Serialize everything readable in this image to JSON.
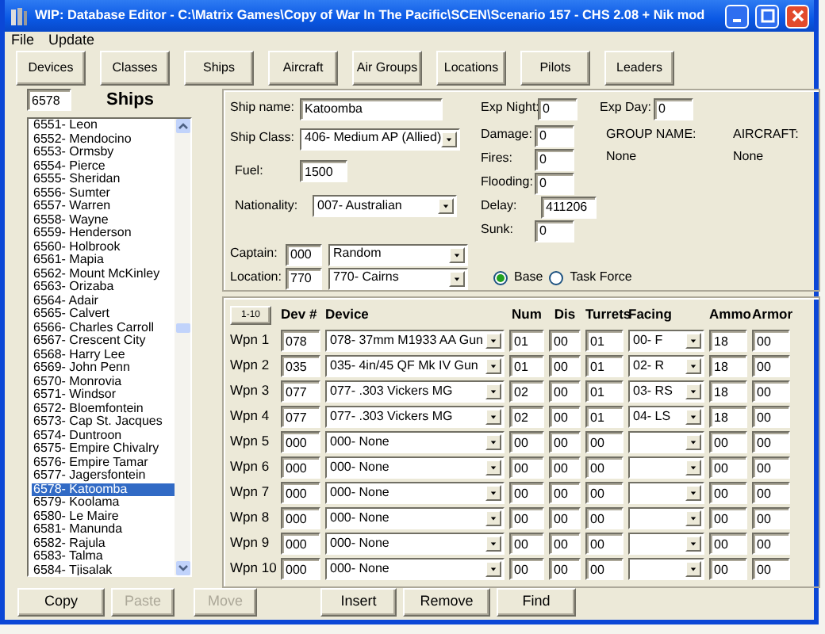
{
  "window": {
    "title": "WIP: Database Editor - C:\\Matrix Games\\Copy of War In The Pacific\\SCEN\\Scenario 157 - CHS 2.08 + Nik mod"
  },
  "menu": [
    "File",
    "Update"
  ],
  "nav_buttons": [
    "Devices",
    "Classes",
    "Ships",
    "Aircraft",
    "Air Groups",
    "Locations",
    "Pilots",
    "Leaders"
  ],
  "ship_list": {
    "search": "6578",
    "title": "Ships",
    "items": [
      {
        "label": "6551- Leon",
        "selected": false
      },
      {
        "label": "6552- Mendocino",
        "selected": false
      },
      {
        "label": "6553- Ormsby",
        "selected": false
      },
      {
        "label": "6554- Pierce",
        "selected": false
      },
      {
        "label": "6555- Sheridan",
        "selected": false
      },
      {
        "label": "6556- Sumter",
        "selected": false
      },
      {
        "label": "6557- Warren",
        "selected": false
      },
      {
        "label": "6558- Wayne",
        "selected": false
      },
      {
        "label": "6559- Henderson",
        "selected": false
      },
      {
        "label": "6560- Holbrook",
        "selected": false
      },
      {
        "label": "6561- Mapia",
        "selected": false
      },
      {
        "label": "6562- Mount McKinley",
        "selected": false
      },
      {
        "label": "6563- Orizaba",
        "selected": false
      },
      {
        "label": "6564- Adair",
        "selected": false
      },
      {
        "label": "6565- Calvert",
        "selected": false
      },
      {
        "label": "6566- Charles Carroll",
        "selected": false
      },
      {
        "label": "6567- Crescent City",
        "selected": false
      },
      {
        "label": "6568- Harry Lee",
        "selected": false
      },
      {
        "label": "6569- John Penn",
        "selected": false
      },
      {
        "label": "6570- Monrovia",
        "selected": false
      },
      {
        "label": "6571- Windsor",
        "selected": false
      },
      {
        "label": "6572- Bloemfontein",
        "selected": false
      },
      {
        "label": "6573- Cap St. Jacques",
        "selected": false
      },
      {
        "label": "6574- Duntroon",
        "selected": false
      },
      {
        "label": "6575- Empire Chivalry",
        "selected": false
      },
      {
        "label": "6576- Empire Tamar",
        "selected": false
      },
      {
        "label": "6577- Jagersfontein",
        "selected": false
      },
      {
        "label": "6578- Katoomba",
        "selected": true
      },
      {
        "label": "6579- Koolama",
        "selected": false
      },
      {
        "label": "6580- Le Maire",
        "selected": false
      },
      {
        "label": "6581- Manunda",
        "selected": false
      },
      {
        "label": "6582- Rajula",
        "selected": false
      },
      {
        "label": "6583- Talma",
        "selected": false
      },
      {
        "label": "6584- Tjisalak",
        "selected": false
      }
    ]
  },
  "ship": {
    "ship_name": {
      "label": "Ship name:",
      "value": "Katoomba"
    },
    "ship_class": {
      "label": "Ship Class:",
      "value": "406- Medium AP (Allied)"
    },
    "fuel": {
      "label": "Fuel:",
      "value": "1500"
    },
    "nationality": {
      "label": "Nationality:",
      "value": "007- Australian"
    },
    "exp_night": {
      "label": "Exp Night:",
      "value": "0"
    },
    "exp_day": {
      "label": "Exp Day:",
      "value": "0"
    },
    "damage": {
      "label": "Damage:",
      "value": "0"
    },
    "fires": {
      "label": "Fires:",
      "value": "0"
    },
    "flooding": {
      "label": "Flooding:",
      "value": "0"
    },
    "delay": {
      "label": "Delay:",
      "value": "411206"
    },
    "sunk": {
      "label": "Sunk:",
      "value": "0"
    },
    "group_name": {
      "label": "GROUP NAME:",
      "value": "None"
    },
    "aircraft": {
      "label": "AIRCRAFT:",
      "value": "None"
    },
    "captain": {
      "label": "Captain:",
      "code": "000",
      "value": "Random"
    },
    "location": {
      "label": "Location:",
      "code": "770",
      "value": "770- Cairns"
    },
    "location_type": [
      {
        "label": "Base",
        "selected": true
      },
      {
        "label": "Task Force",
        "selected": false
      }
    ]
  },
  "weapons": {
    "page_button": "1-10",
    "columns": [
      "Dev #",
      "Device",
      "Num",
      "Dis",
      "Turrets",
      "Facing",
      "Ammo",
      "Armor"
    ],
    "rows": [
      {
        "label": "Wpn 1",
        "dev": "078",
        "device": "078- 37mm M1933 AA Gun",
        "num": "01",
        "dis": "00",
        "turrets": "01",
        "facing": "00- F",
        "ammo": "18",
        "armor": "00"
      },
      {
        "label": "Wpn 2",
        "dev": "035",
        "device": "035- 4in/45 QF Mk IV Gun",
        "num": "01",
        "dis": "00",
        "turrets": "01",
        "facing": "02- R",
        "ammo": "18",
        "armor": "00"
      },
      {
        "label": "Wpn 3",
        "dev": "077",
        "device": "077- .303 Vickers MG",
        "num": "02",
        "dis": "00",
        "turrets": "01",
        "facing": "03- RS",
        "ammo": "18",
        "armor": "00"
      },
      {
        "label": "Wpn 4",
        "dev": "077",
        "device": "077- .303 Vickers MG",
        "num": "02",
        "dis": "00",
        "turrets": "01",
        "facing": "04- LS",
        "ammo": "18",
        "armor": "00"
      },
      {
        "label": "Wpn 5",
        "dev": "000",
        "device": "000- None",
        "num": "00",
        "dis": "00",
        "turrets": "00",
        "ammo": "00",
        "armor": "00"
      },
      {
        "label": "Wpn 6",
        "dev": "000",
        "device": "000- None",
        "num": "00",
        "dis": "00",
        "turrets": "00",
        "ammo": "00",
        "armor": "00"
      },
      {
        "label": "Wpn 7",
        "dev": "000",
        "device": "000- None",
        "num": "00",
        "dis": "00",
        "turrets": "00",
        "ammo": "00",
        "armor": "00"
      },
      {
        "label": "Wpn 8",
        "dev": "000",
        "device": "000- None",
        "num": "00",
        "dis": "00",
        "turrets": "00",
        "ammo": "00",
        "armor": "00"
      },
      {
        "label": "Wpn 9",
        "dev": "000",
        "device": "000- None",
        "num": "00",
        "dis": "00",
        "turrets": "00",
        "ammo": "00",
        "armor": "00"
      },
      {
        "label": "Wpn 10",
        "dev": "000",
        "device": "000- None",
        "num": "00",
        "dis": "00",
        "turrets": "00",
        "ammo": "00",
        "armor": "00"
      }
    ]
  },
  "bottom_buttons": [
    {
      "label": "Copy",
      "disabled": false
    },
    {
      "label": "Paste",
      "disabled": true
    },
    {
      "label": "Move",
      "disabled": true
    },
    {
      "label": "Insert",
      "disabled": false
    },
    {
      "label": "Remove",
      "disabled": false
    },
    {
      "label": "Find",
      "disabled": false
    }
  ]
}
